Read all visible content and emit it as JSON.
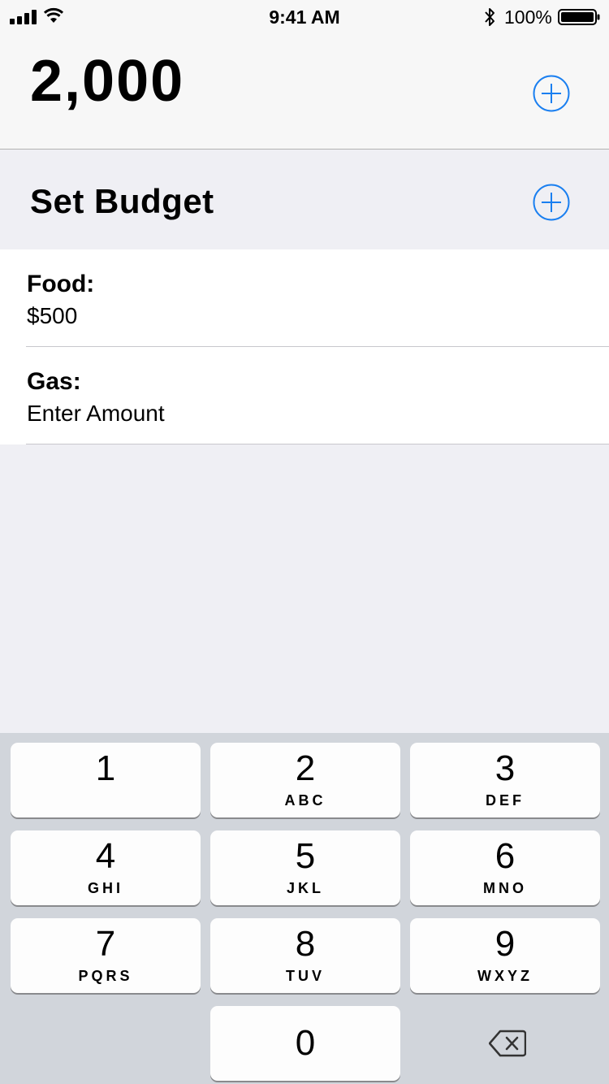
{
  "status_bar": {
    "time": "9:41 AM",
    "battery_percent": "100%"
  },
  "header": {
    "total": "2,000",
    "add_icon": "plus-circle-icon"
  },
  "budget": {
    "title": "Set Budget",
    "add_icon": "plus-circle-icon",
    "items": [
      {
        "label": "Food:",
        "value": "$500"
      },
      {
        "label": "Gas:",
        "value": "Enter Amount"
      }
    ]
  },
  "keypad": {
    "keys": [
      {
        "digit": "1",
        "letters": ""
      },
      {
        "digit": "2",
        "letters": "ABC"
      },
      {
        "digit": "3",
        "letters": "DEF"
      },
      {
        "digit": "4",
        "letters": "GHI"
      },
      {
        "digit": "5",
        "letters": "JKL"
      },
      {
        "digit": "6",
        "letters": "MNO"
      },
      {
        "digit": "7",
        "letters": "PQRS"
      },
      {
        "digit": "8",
        "letters": "TUV"
      },
      {
        "digit": "9",
        "letters": "WXYZ"
      },
      {
        "digit": "0",
        "letters": ""
      }
    ],
    "delete_icon": "backspace-icon"
  },
  "colors": {
    "accent": "#1a7ff0",
    "keypad_bg": "#d1d5db",
    "grouped_bg": "#efeff4"
  }
}
